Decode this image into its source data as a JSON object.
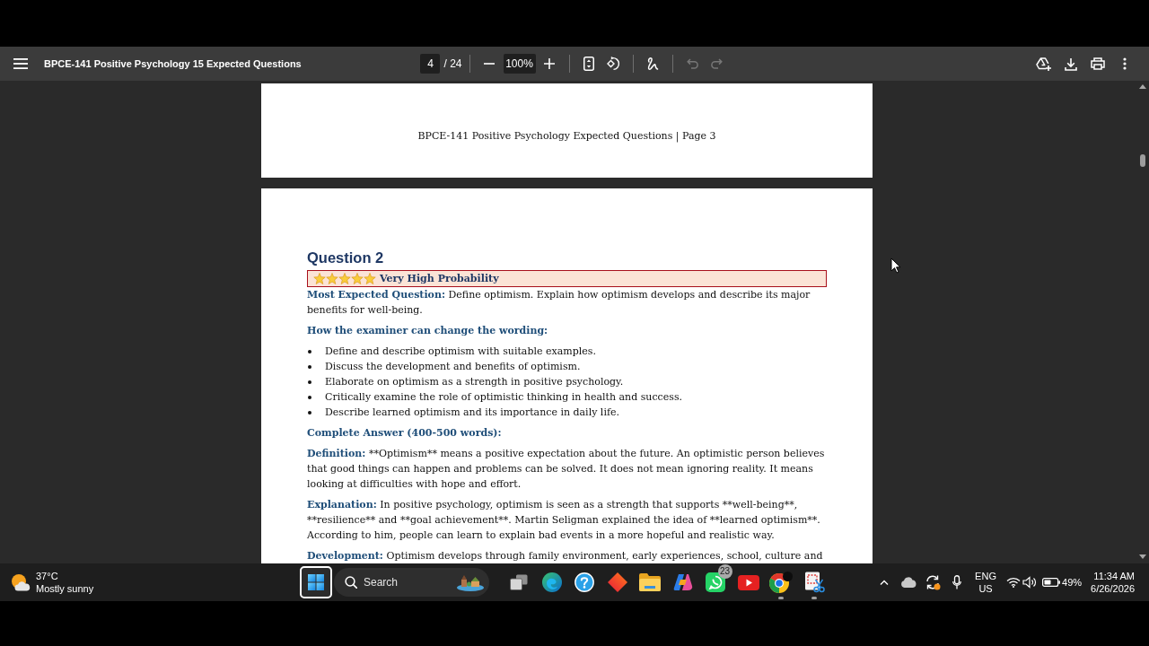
{
  "toolbar": {
    "title": "BPCE-141 Positive Psychology 15 Expected Questions",
    "page_number": "4",
    "page_total": "/ 24",
    "zoom": "100%",
    "tool_groups": [
      [
        {
          "kind": "fit-page",
          "disabled": false
        },
        {
          "kind": "rotate",
          "disabled": false
        }
      ],
      [
        {
          "kind": "draw",
          "disabled": false
        }
      ],
      [
        {
          "kind": "undo",
          "disabled": true
        },
        {
          "kind": "redo",
          "disabled": true
        }
      ]
    ],
    "actions": [
      {
        "kind": "drive-add"
      },
      {
        "kind": "download"
      },
      {
        "kind": "print"
      },
      {
        "kind": "more"
      }
    ]
  },
  "document": {
    "pages": [
      {
        "kind": "footer",
        "footer": "BPCE-141 Positive Psychology Expected Questions | Page 3"
      },
      {
        "kind": "content",
        "heading": "Question 2",
        "banner": {
          "stars": 5,
          "label": "Very High Probability"
        },
        "blocks": [
          {
            "kind": "paragraph",
            "label": "Most Expected Question:",
            "text": "Define optimism. Explain how optimism develops and describe its major benefits for well-being."
          },
          {
            "kind": "subheading",
            "text": "How the examiner can change the wording:"
          },
          {
            "kind": "bullets",
            "items": [
              "Define and describe optimism with suitable examples.",
              "Discuss the development and benefits of optimism.",
              "Elaborate on optimism as a strength in positive psychology.",
              "Critically examine the role of optimistic thinking in health and success.",
              "Describe learned optimism and its importance in daily life."
            ]
          },
          {
            "kind": "subheading",
            "text": "Complete Answer (400-500 words):"
          },
          {
            "kind": "paragraph",
            "label": "Definition:",
            "text": "**Optimism** means a positive expectation about the future. An optimistic person believes that good things can happen and problems can be solved. It does not mean ignoring reality. It means looking at difficulties with hope and effort."
          },
          {
            "kind": "paragraph",
            "label": "Explanation:",
            "text": "In positive psychology, optimism is seen as a strength that supports **well-being**, **resilience** and **goal achievement**. Martin Seligman explained the idea of **learned optimism**. According to him, people can learn to explain bad events in a more hopeful and realistic way."
          },
          {
            "kind": "paragraph",
            "label": "Development:",
            "text": "Optimism develops through family environment, early experiences, school, culture and"
          }
        ]
      }
    ]
  },
  "taskbar": {
    "weather": {
      "temperature": "37°C",
      "condition": "Mostly sunny"
    },
    "start": {
      "focused": true
    },
    "search": {
      "placeholder": "Search"
    },
    "apps": [
      {
        "kind": "task-view",
        "running": false
      },
      {
        "kind": "swirl",
        "running": false
      },
      {
        "kind": "help",
        "running": false
      },
      {
        "kind": "diamond",
        "running": false
      },
      {
        "kind": "folder",
        "running": false
      },
      {
        "kind": "ribbon",
        "running": false
      },
      {
        "kind": "chat",
        "running": false,
        "badge": "23"
      },
      {
        "kind": "play",
        "running": false
      },
      {
        "kind": "tricolor",
        "running": true
      },
      {
        "kind": "snip",
        "running": true
      }
    ],
    "tray": {
      "language": "ENG",
      "region": "US",
      "battery": "49%",
      "time": "11:34 AM",
      "date": "6/26/2026"
    }
  }
}
